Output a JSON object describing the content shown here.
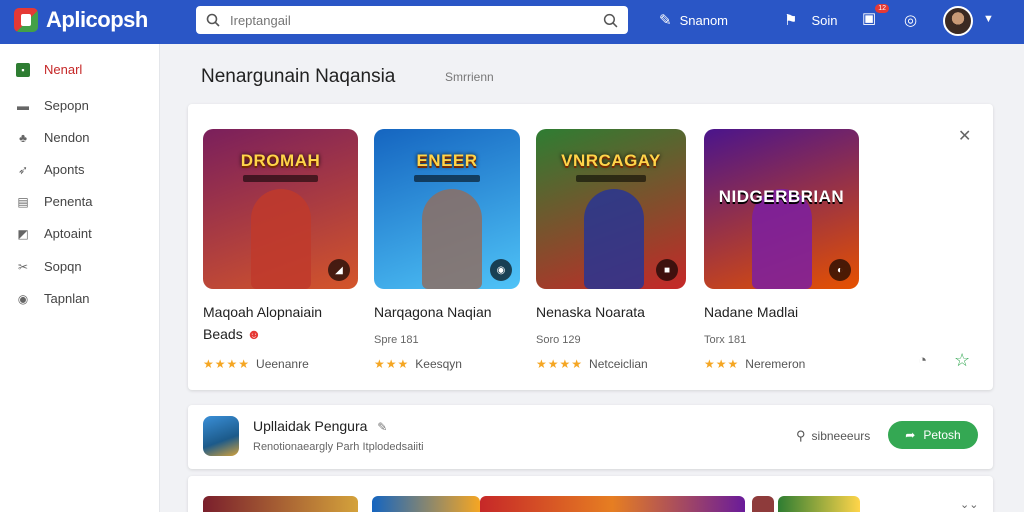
{
  "app": {
    "name": "Aplicopsh"
  },
  "search": {
    "placeholder": "Ireptangail"
  },
  "top_actions": {
    "share_label": "Snanom",
    "sign_label": "Soin",
    "badge": "12"
  },
  "sidebar": {
    "items": [
      {
        "label": "Nenarl",
        "icon": "home-icon",
        "active": true
      },
      {
        "label": "Sepopn",
        "icon": "monitor-icon"
      },
      {
        "label": "Nendon",
        "icon": "puzzle-icon"
      },
      {
        "label": "Aponts",
        "icon": "leaf-icon"
      },
      {
        "label": "Penenta",
        "icon": "list-icon"
      },
      {
        "label": "Aptoaint",
        "icon": "chart-icon"
      },
      {
        "label": "Sopqn",
        "icon": "tools-icon"
      },
      {
        "label": "Tapnlan",
        "icon": "chat-icon"
      }
    ]
  },
  "section": {
    "title": "Nenargunain Naqansia",
    "subtitle": "Smrrienn"
  },
  "games": [
    {
      "art_title": "DROMAH",
      "name": "Maqoah Alopnaiain",
      "name2": "Beads",
      "meta": "",
      "rating_text": "Ueenanre",
      "stars": "★★★★",
      "colors": [
        "#7a1f5c",
        "#d4552a"
      ],
      "hero": "#c0392b",
      "corner": "◢"
    },
    {
      "art_title": "ENEER",
      "name": "Narqagona Naqian",
      "name2": "",
      "meta": "Spre 181",
      "rating_text": "Keesqyn",
      "stars": "★★★",
      "colors": [
        "#1565c0",
        "#4fc3f7"
      ],
      "hero": "#8d6e63",
      "corner": "◉"
    },
    {
      "art_title": "VNRCAGAY",
      "name": "Nenaska Noarata",
      "name2": "",
      "meta": "Soro 129",
      "rating_text": "Netceiclian",
      "stars": "★★★★",
      "colors": [
        "#2e7d32",
        "#c62828"
      ],
      "hero": "#283593",
      "corner": "■"
    },
    {
      "art_title": "NIDGERBRIAN",
      "name": "Nadane Madlai",
      "name2": "",
      "meta": "Torx 181",
      "rating_text": "Neremeron",
      "stars": "★★★",
      "colors": [
        "#4a148c",
        "#e65100"
      ],
      "hero": "#7b1fa2",
      "corner": "◐"
    }
  ],
  "featured": {
    "title": "Upllaidak Pengura",
    "description": "Renotionaeargly Parh Itplodedsaiiti",
    "people_label": "sibneeeurs",
    "install_label": "Petosh"
  },
  "colors": {
    "topbar": "#2a56c6",
    "install": "#34a853",
    "active_label": "#c62828"
  }
}
